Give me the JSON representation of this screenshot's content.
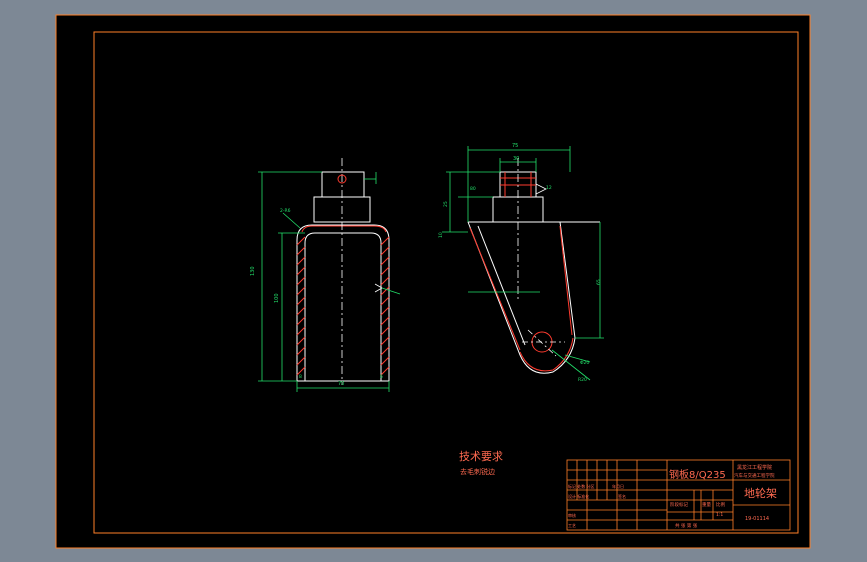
{
  "colors": {
    "background": "#7d8895",
    "paper": "#000000",
    "border": "#ff7f27",
    "geometry": "#ffffff",
    "section": "#ff3b2f",
    "dimension": "#22e06a",
    "centerline": "#ffffff",
    "note_text": "#ff6a50",
    "title_text": "#ff6a50"
  },
  "drawing": {
    "notes_title": "技术要求",
    "notes_line": "去毛刺锐边",
    "front_dim_bottom": "70",
    "front_dim_height": "130",
    "front_dim_inner": "100",
    "front_dim_thk": "8",
    "front_dim_tag": "2-R6",
    "front_dim_r6": "6",
    "side_dim_top": "75",
    "side_dim_boss": "30",
    "side_dim_height": "80",
    "side_dim_left": "25",
    "side_dim_left2": "10",
    "side_dim_right": "65",
    "side_dim_hole": "Φ20",
    "side_dim_r": "R20",
    "side_dim_weld": "12"
  },
  "title_block": {
    "material": "钢板8/Q235",
    "school_line1": "黑龙江工程学院",
    "school_line2": "汽车与交通工程学院",
    "part_name": "地轮架",
    "drawing_no": "19-01114",
    "scale": "1:1",
    "stage_label": "阶段标记",
    "weight_label": "重量",
    "scale_label": "比例",
    "sheet_label": "共 张 第 张",
    "designer_row": "标记 处数 分区",
    "approve_row": "设计 标准化",
    "review_row": "审核",
    "craft_row": "工艺",
    "date_label": "年月日",
    "sign_label": "签名"
  }
}
